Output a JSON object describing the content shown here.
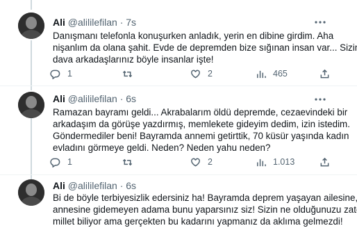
{
  "tweets": [
    {
      "name": "Ali",
      "handle": "@alililefilan",
      "separator": "·",
      "time": "7s",
      "lines": [
        "Danışmanı telefonla konuşurken anladık, yerin en dibine girdim. Aha",
        "nişanlım da olana şahit. Evde de depremden bize sığınan insan var... Sizin",
        "dava arkadaşlarınız böyle insanlar işte!"
      ],
      "replies": "1",
      "retweets": "",
      "likes": "2",
      "views": "465"
    },
    {
      "name": "Ali",
      "handle": "@alililefilan",
      "separator": "·",
      "time": "6s",
      "lines": [
        "Ramazan bayramı geldi... Akrabalarım öldü depremde, cezaevindeki bir",
        "arkadaşım da görüşe yazdırmış, memlekete gideyim dedim, izin istedim.",
        "Göndermediler beni! Bayramda annemi getirttik, 70 küsür yaşında kadın",
        "evladını görmeye geldi. Neden? Neden yahu neden?"
      ],
      "replies": "1",
      "retweets": "",
      "likes": "2",
      "views": "1.013"
    },
    {
      "name": "Ali",
      "handle": "@alililefilan",
      "separator": "·",
      "time": "6s",
      "lines": [
        "Bi de böyle terbiyesizlik edersiniz ha! Bayramda deprem yaşayan ailesine,",
        "annesine gidemeyen adama bunu yaparsınız siz! Sizin ne olduğunuzu zaten",
        "millet biliyor ama gerçekten bu kadarını yapmanız da aklıma gelmezdi!"
      ]
    }
  ],
  "icons": {
    "reply": "speech-bubble",
    "retweet": "retweet-arrows",
    "like": "heart",
    "views": "bar-chart",
    "share": "upload-arrow",
    "more": "ellipsis"
  },
  "colors": {
    "text": "#0f1419",
    "secondary": "#536471",
    "thread": "#cfd9de",
    "divider": "#eff3f4"
  }
}
